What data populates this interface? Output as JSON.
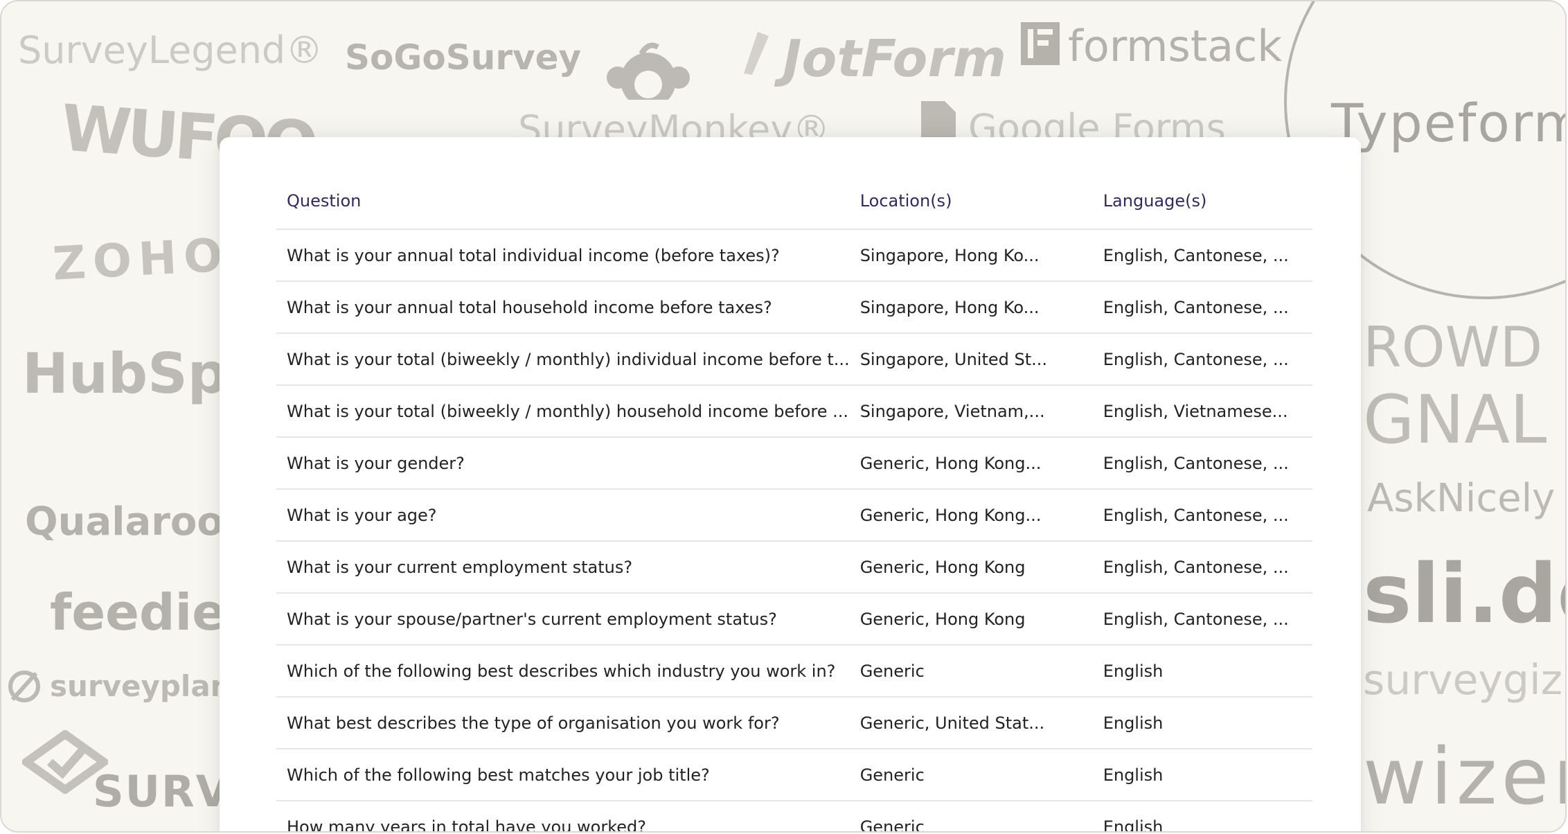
{
  "background_logos": {
    "surveylegend": "SurveyLegend®",
    "sogosurvey": "SoGoSurvey",
    "jotform": "JotForm",
    "formstack": "formstack",
    "wufoo": "WUFOO",
    "surveymonkey": "SurveyMonkey®",
    "google_forms": "Google Forms",
    "typeform": "Typeform",
    "zoho": "ZOHO",
    "hubspot": "HubSpot",
    "crowdsignal_line1": "ROWD",
    "crowdsignal_line2": "GNAL",
    "asknicely": "AskNicely",
    "qualaroo": "Qualaroo",
    "slido": "sli.do",
    "feedier": "feedier",
    "surveyplanet": "surveyplanet",
    "surveygizmo": "surveygizmo",
    "survicate": "SURVIC",
    "wizer": "wizer"
  },
  "table": {
    "headers": {
      "question": "Question",
      "locations": "Location(s)",
      "languages": "Language(s)"
    },
    "rows": [
      {
        "question": "What is your annual total individual income (before taxes)?",
        "locations": "Singapore, Hong Ko...",
        "languages": "English, Cantonese, ..."
      },
      {
        "question": "What is your annual total household income before taxes?",
        "locations": "Singapore, Hong Ko...",
        "languages": "English, Cantonese, ..."
      },
      {
        "question": "What is your total (biweekly / monthly) individual income before t...",
        "locations": "Singapore, United St...",
        "languages": "English, Cantonese, ..."
      },
      {
        "question": "What is your total (biweekly / monthly) household income before ...",
        "locations": "Singapore, Vietnam,...",
        "languages": "English, Vietnamese..."
      },
      {
        "question": "What is your gender?",
        "locations": "Generic, Hong Kong...",
        "languages": "English, Cantonese, ..."
      },
      {
        "question": "What is your age?",
        "locations": "Generic, Hong Kong...",
        "languages": "English, Cantonese, ..."
      },
      {
        "question": "What is your current employment status?",
        "locations": "Generic, Hong Kong",
        "languages": "English, Cantonese, ..."
      },
      {
        "question": "What is your spouse/partner's current employment status?",
        "locations": "Generic, Hong Kong",
        "languages": "English, Cantonese, ..."
      },
      {
        "question": "Which of the following best describes which industry you work in?",
        "locations": "Generic",
        "languages": "English"
      },
      {
        "question": "What best describes the type of organisation you work for?",
        "locations": "Generic, United Stat...",
        "languages": "English"
      },
      {
        "question": "Which of the following best matches your job title?",
        "locations": "Generic",
        "languages": "English"
      },
      {
        "question": "How many years in total have you worked?",
        "locations": "Generic",
        "languages": "English"
      }
    ]
  },
  "colors": {
    "background": "#f8f6f1",
    "logo_gray": "#bdbab4",
    "header_text": "#2f2869",
    "cell_text": "#222222",
    "divider": "#e6e6e6"
  }
}
